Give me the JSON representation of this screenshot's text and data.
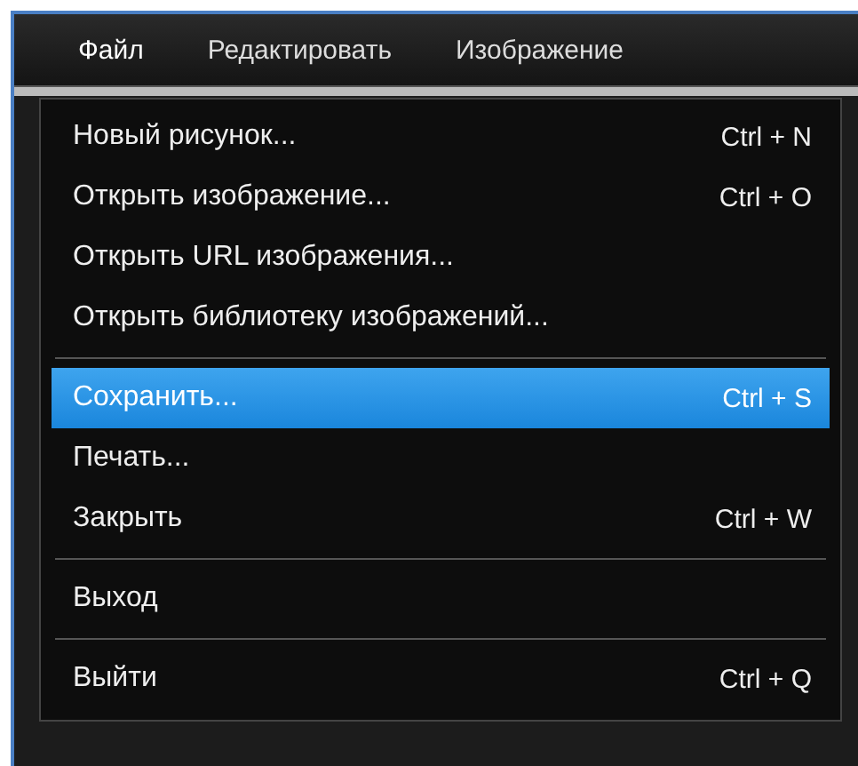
{
  "menu_bar": [
    {
      "label": "Файл",
      "selected": true
    },
    {
      "label": "Редактировать",
      "selected": false
    },
    {
      "label": "Изображение",
      "selected": false
    }
  ],
  "file_menu": [
    {
      "kind": "item",
      "label": "Новый рисунок...",
      "shortcut": "Ctrl + N",
      "selected": false
    },
    {
      "kind": "item",
      "label": "Открыть изображение...",
      "shortcut": "Ctrl + O",
      "selected": false
    },
    {
      "kind": "item",
      "label": "Открыть URL изображения...",
      "selected": false
    },
    {
      "kind": "item",
      "label": "Открыть библиотеку изображений...",
      "selected": false
    },
    {
      "kind": "separator"
    },
    {
      "kind": "item",
      "label": "Сохранить...",
      "shortcut": "Ctrl + S",
      "selected": true
    },
    {
      "kind": "item",
      "label": "Печать...",
      "selected": false
    },
    {
      "kind": "item",
      "label": "Закрыть",
      "shortcut": "Ctrl + W",
      "selected": false
    },
    {
      "kind": "separator"
    },
    {
      "kind": "item",
      "label": "Выход",
      "selected": false
    },
    {
      "kind": "separator"
    },
    {
      "kind": "item",
      "label": "Выйти",
      "shortcut": "Ctrl + Q",
      "selected": false
    }
  ]
}
